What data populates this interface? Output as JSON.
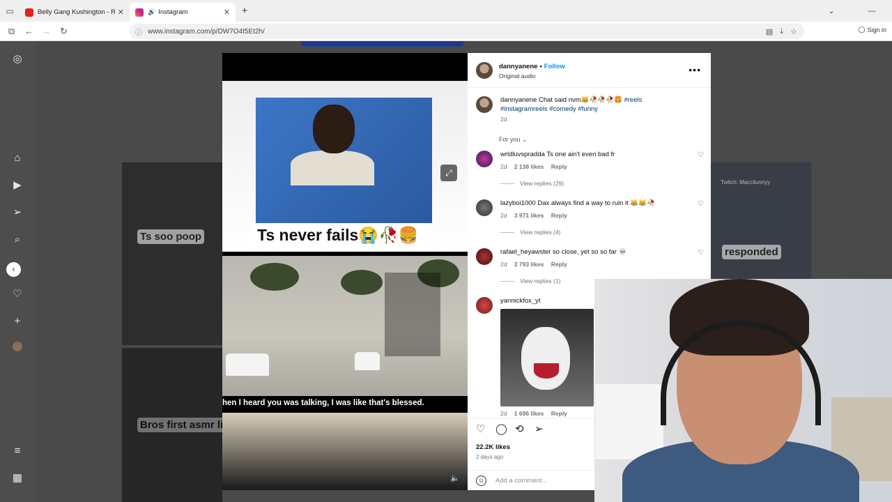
{
  "browser": {
    "tabs": [
      {
        "title": "Belly Gang Kushington - Rent D",
        "active": false
      },
      {
        "title": "Instagram",
        "active": true
      }
    ],
    "url": "www.instagram.com/p/DW7O4t5Et2h/",
    "sign_in": "Sign in"
  },
  "background": {
    "captions": [
      "Ts soo poop",
      "Bros first asmr list",
      "responded",
      "Twitch: Maccilunnyy"
    ]
  },
  "post": {
    "username": "dannyanene",
    "follow": "Follow",
    "audio": "Original audio",
    "video_caption": "Ts never fails😭🥀🍔",
    "video_subtitle": "hen I heard you was talking, I was like that's blessed.",
    "caption_user": "dannyanene",
    "caption_text": "Chat said nvm😹🥀🥀🥀🍔",
    "caption_tags": "#reels #instagramreels #comedy #funny",
    "caption_age": "2d",
    "for_you": "For you",
    "comments": [
      {
        "user": "wrldluvspradda",
        "text": "Ts one ain't even bad fr",
        "age": "2d",
        "likes": "2 138 likes",
        "reply": "Reply",
        "view_replies": "View replies (29)"
      },
      {
        "user": "lazyboi1000",
        "text": "Dax always find a way to ruin it 😹😹🥀",
        "age": "2d",
        "likes": "3 971 likes",
        "reply": "Reply",
        "view_replies": "View replies (4)"
      },
      {
        "user": "rafael_heyawster",
        "text": "so close, yet so so far 💀",
        "age": "2d",
        "likes": "2 793 likes",
        "reply": "Reply",
        "view_replies": "View replies (1)"
      },
      {
        "user": "yannickfox_yt",
        "text": "",
        "age": "2d",
        "likes": "1 696 likes",
        "reply": "Reply"
      }
    ],
    "total_likes": "22.2K likes",
    "posted": "2 days ago",
    "add_comment_placeholder": "Add a comment..."
  },
  "icons": {
    "sidebar": [
      "instagram-icon",
      "home-icon",
      "reels-icon",
      "send-icon",
      "search-icon",
      "explore-icon",
      "notifications-icon",
      "create-icon",
      "profile-icon",
      "menu-icon",
      "more-apps-icon"
    ]
  }
}
